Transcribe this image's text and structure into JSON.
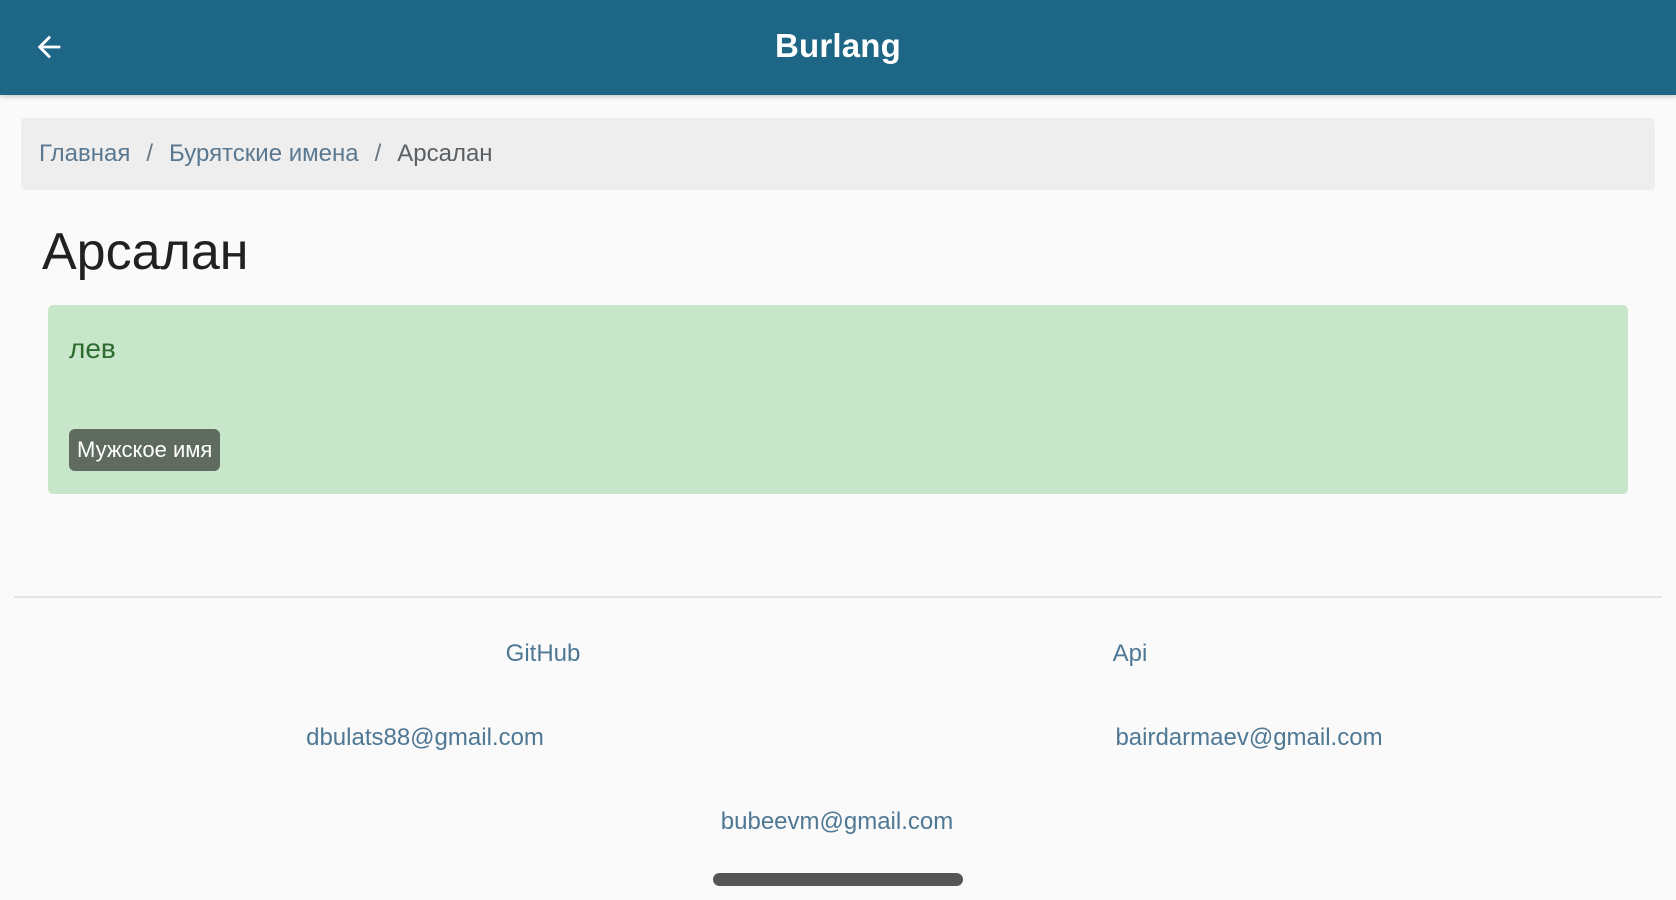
{
  "app": {
    "title": "Burlang",
    "back_icon": "arrow-left-icon"
  },
  "colors": {
    "app_bar": "#1d6686",
    "card_background": "#c8e6c9",
    "badge_background": "#5e6b5e"
  },
  "breadcrumb": {
    "items": [
      "Главная",
      "Бурятские имена",
      "Арсалан"
    ],
    "separator": "/"
  },
  "page": {
    "title": "Арсалан",
    "meaning": "лев",
    "badge": "Мужское имя"
  },
  "footer": {
    "links": [
      "GitHub",
      "Api"
    ],
    "emails": [
      "dbulats88@gmail.com",
      "bairdarmaev@gmail.com",
      "bubeevm@gmail.com"
    ]
  }
}
